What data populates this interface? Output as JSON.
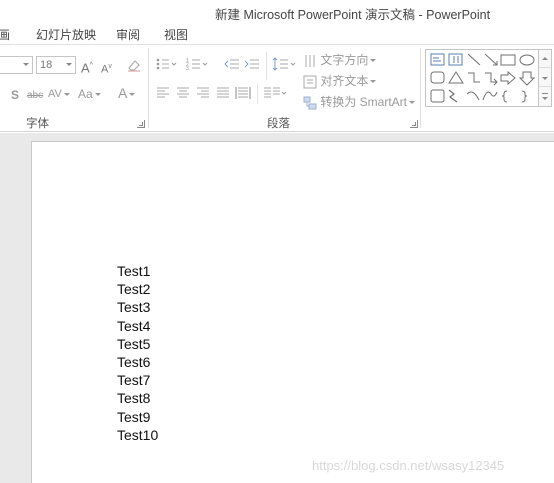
{
  "window": {
    "title": "新建 Microsoft PowerPoint 演示文稿 - PowerPoint"
  },
  "tabs": [
    {
      "label": "画"
    },
    {
      "label": "幻灯片放映"
    },
    {
      "label": "审阅"
    },
    {
      "label": "视图"
    }
  ],
  "ribbon": {
    "font_group": {
      "label": "字体",
      "font_size": "18",
      "grow_font": "A",
      "shrink_font": "A",
      "shadow": "S",
      "strikethrough": "abc",
      "char_spacing": "AV",
      "change_case": "Aa",
      "font_color": "A"
    },
    "paragraph_group": {
      "label": "段落",
      "text_direction": "文字方向",
      "align_text": "对齐文本",
      "convert_smartart": "转换为 SmartArt"
    }
  },
  "slide": {
    "lines": [
      "Test1",
      "Test2",
      "Test3",
      "Test4",
      "Test5",
      "Test6",
      "Test7",
      "Test8",
      "Test9",
      "Test10"
    ]
  },
  "watermark": "https://blog.csdn.net/wsasy12345"
}
